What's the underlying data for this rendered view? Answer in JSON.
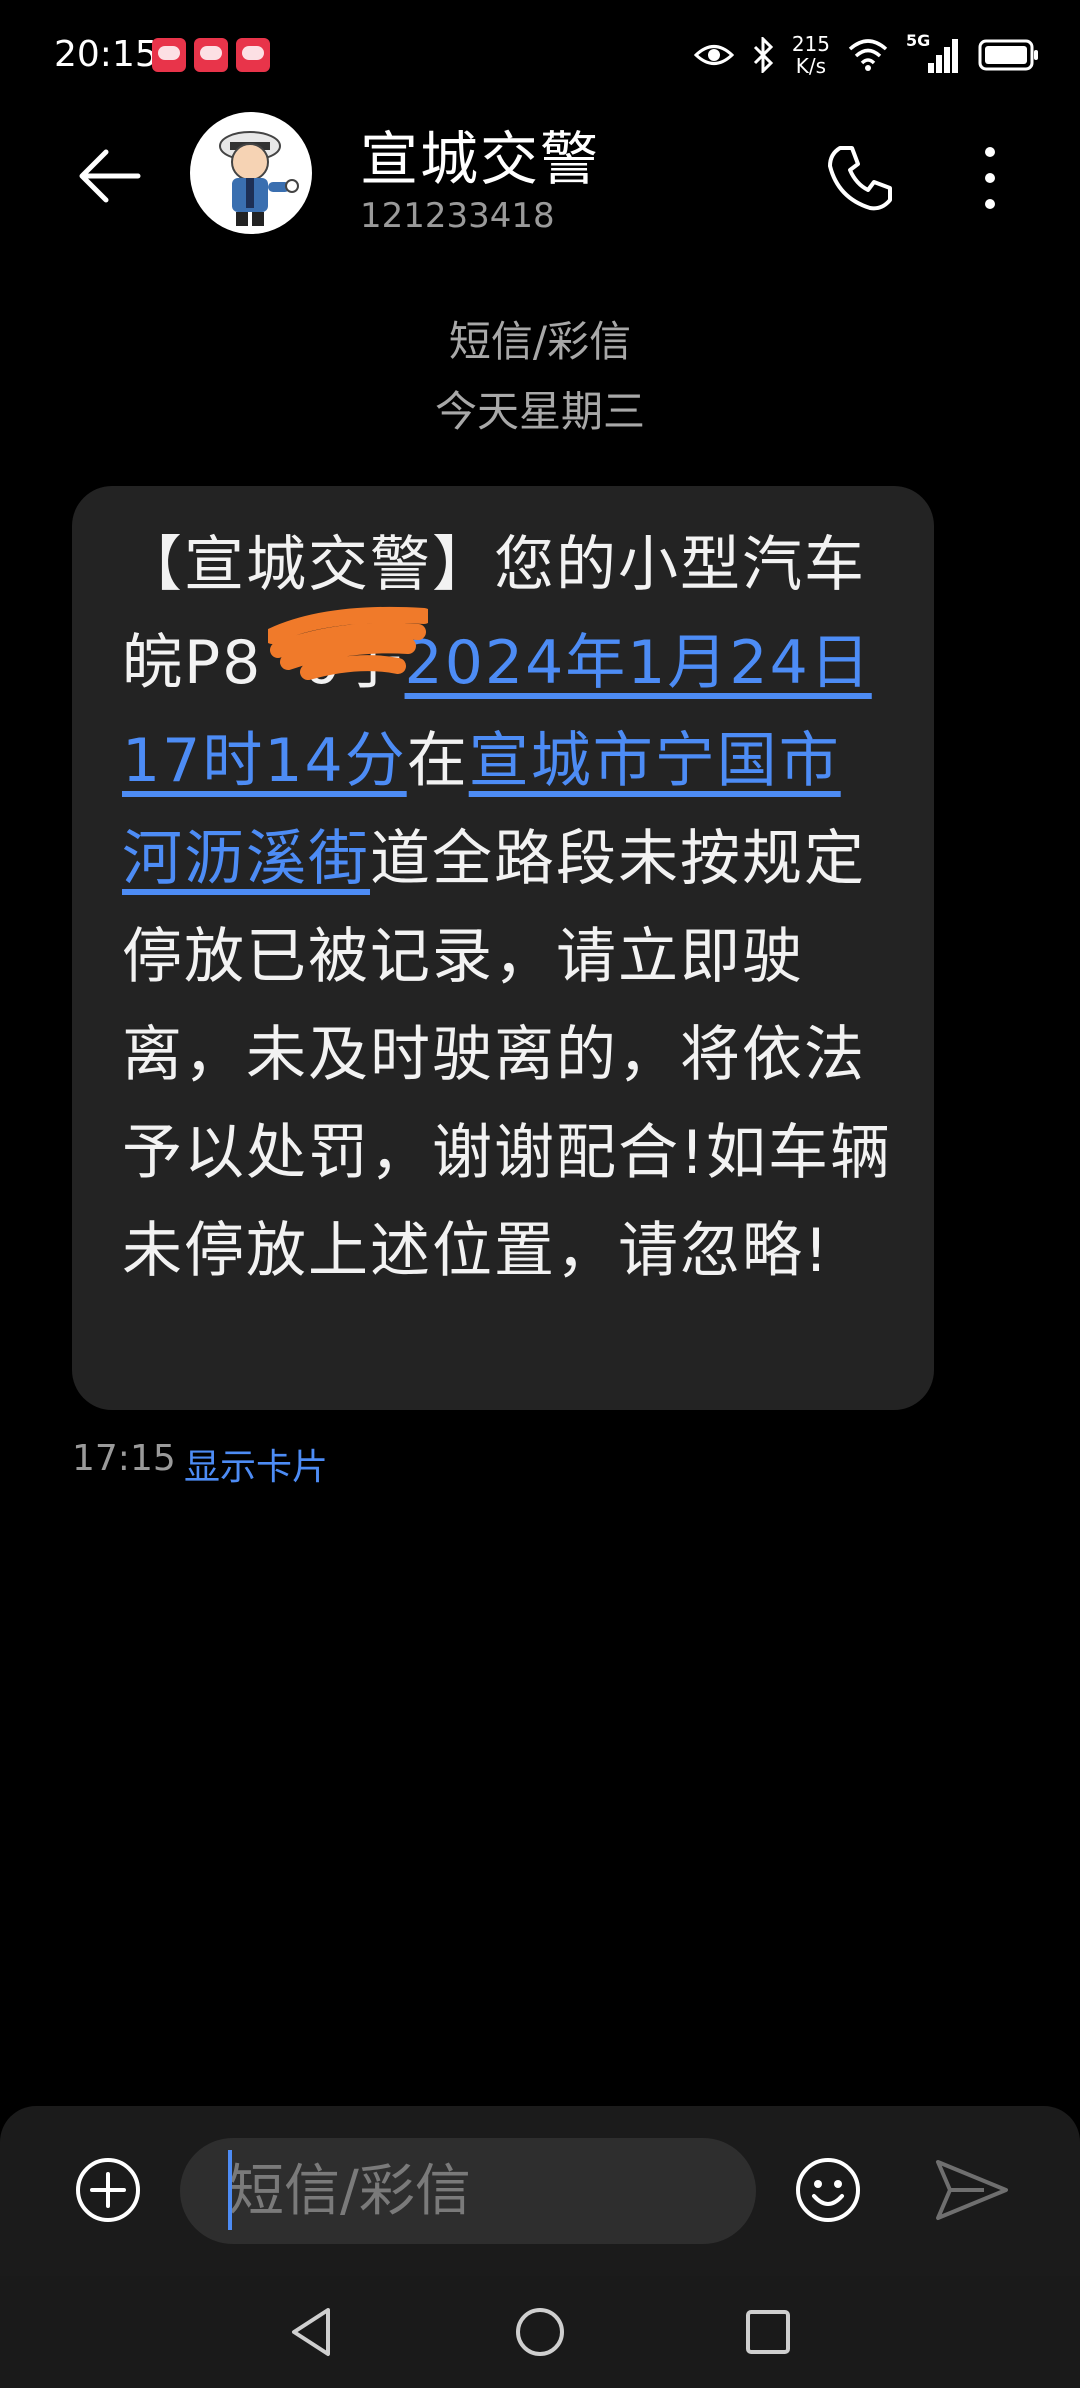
{
  "status_bar": {
    "time": "20:15",
    "net_speed_value": "215",
    "net_speed_unit": "K/s",
    "signal_label": "5G",
    "icons": [
      "eye-icon",
      "bluetooth-icon",
      "wifi-icon",
      "signal-icon",
      "battery-icon"
    ]
  },
  "header": {
    "contact_name": "宣城交警",
    "contact_number": "121233418"
  },
  "conversation": {
    "message_type": "短信/彩信",
    "date_label": "今天星期三"
  },
  "message": {
    "part1": "【宣城交警】您的小型汽车皖P8",
    "part2": "0于",
    "link_datetime": "2024年1月24日17时14分",
    "part3": "在",
    "link_location": "宣城市宁国市河沥溪街",
    "part4": "道全路段未按规定停放已被记录，请立即驶离，未及时驶离的，将依法予以处罚，谢谢配合!如车辆未停放上述位置，请忽略!",
    "time": "17:15",
    "show_card_label": "显示卡片"
  },
  "input": {
    "placeholder": "短信/彩信"
  },
  "colors": {
    "accent": "#4d8cf5",
    "bubble": "#232323",
    "background": "#000000"
  }
}
